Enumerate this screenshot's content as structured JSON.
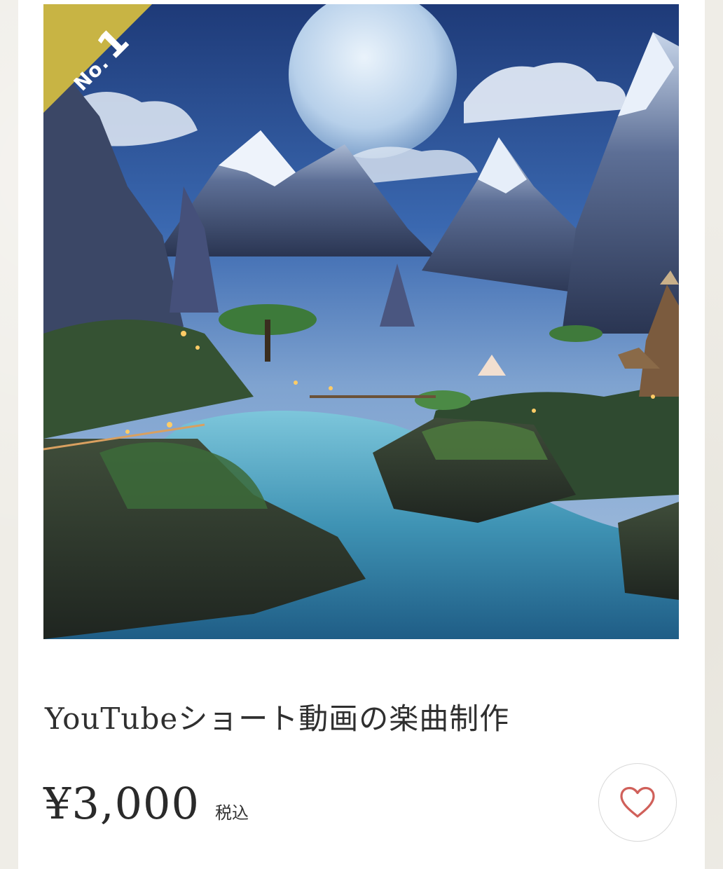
{
  "product": {
    "rank_prefix": "No.",
    "rank_number": "1",
    "image_alt": "fantasy-landscape",
    "title": "YouTubeショート動画の楽曲制作",
    "price": "¥3,000",
    "tax_label": "税込",
    "favorite_icon": "heart-icon"
  },
  "colors": {
    "ribbon": "#c8b444",
    "heart": "#d0605a",
    "text": "#2f2f2f"
  }
}
